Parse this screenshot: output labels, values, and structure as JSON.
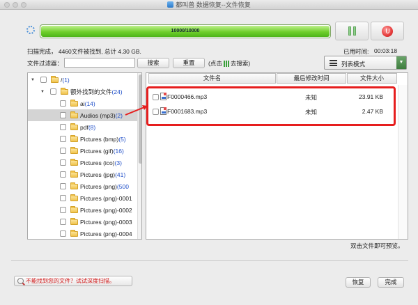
{
  "window": {
    "title": "都叫兽 数据恢复--文件恢复"
  },
  "progress": {
    "text": "10000/10000",
    "fraction": 1.0
  },
  "scan": {
    "status": "扫描完成，  4460文件被找到, 总计 4.30 GB.",
    "elapsed_label": "已用时间:",
    "elapsed_value": "00:03:18"
  },
  "filter": {
    "label": "文件过滤器：",
    "value": "",
    "search_label": "搜索",
    "reset_label": "重置",
    "hint_prefix": "(点击",
    "hint_suffix": "去搜索)"
  },
  "view_mode": {
    "selected": "列表模式"
  },
  "tree": [
    {
      "label": "/ ",
      "count": "(1)"
    },
    {
      "label": "额外找到的文件 ",
      "count": "(24)"
    },
    {
      "label": "ai ",
      "count": "(14)"
    },
    {
      "label": "Audios (mp3) ",
      "count": "(2)"
    },
    {
      "label": "pdf ",
      "count": "(8)"
    },
    {
      "label": "Pictures (bmp) ",
      "count": "(5)"
    },
    {
      "label": "Pictures (gif) ",
      "count": "(16)"
    },
    {
      "label": "Pictures (ico) ",
      "count": "(3)"
    },
    {
      "label": "Pictures (jpg) ",
      "count": "(41)"
    },
    {
      "label": "Pictures (png) ",
      "count": "(500"
    },
    {
      "label": "Pictures (png)-0001",
      "count": ""
    },
    {
      "label": "Pictures (png)-0002",
      "count": ""
    },
    {
      "label": "Pictures (png)-0003",
      "count": ""
    },
    {
      "label": "Pictures (png)-0004",
      "count": ""
    }
  ],
  "columns": {
    "name": "文件名",
    "modified": "最后修改时间",
    "size": "文件大小"
  },
  "files": [
    {
      "name": "F0000466.mp3",
      "modified": "未知",
      "size": "23.91 KB"
    },
    {
      "name": "F0001683.mp3",
      "modified": "未知",
      "size": "2.47 KB"
    }
  ],
  "footer": {
    "preview_hint": "双击文件即可预览。",
    "deep_scan_label": "不能找到您的文件？试试深度扫描。",
    "recover_label": "恢复",
    "finish_label": "完成"
  },
  "colors": {
    "accent_red": "#e61e1e",
    "progress_green": "#6fcf2b",
    "count_blue": "#1f4fc9"
  }
}
